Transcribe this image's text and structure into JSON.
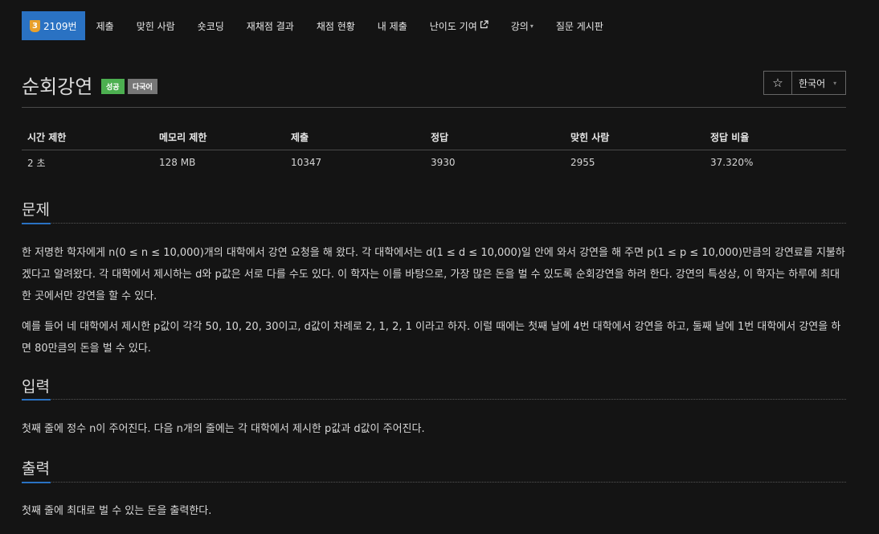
{
  "nav": {
    "problem_badge_tier": "3",
    "problem_number": "2109번",
    "items": [
      {
        "label": "제출"
      },
      {
        "label": "맞힌 사람"
      },
      {
        "label": "숏코딩"
      },
      {
        "label": "재채점 결과"
      },
      {
        "label": "채점 현황"
      },
      {
        "label": "내 제출"
      },
      {
        "label": "난이도 기여"
      },
      {
        "label": "강의"
      },
      {
        "label": "질문 게시판"
      }
    ],
    "difficulty_icon": "external-link-icon",
    "lecture_icon": "caret-down-icon"
  },
  "problem": {
    "title": "순회강연",
    "label_success": "성공",
    "label_lang": "다국어",
    "star_icon": "☆",
    "language": "한국어"
  },
  "info_table": {
    "headers": [
      "시간 제한",
      "메모리 제한",
      "제출",
      "정답",
      "맞힌 사람",
      "정답 비율"
    ],
    "values": [
      "2 초",
      "128 MB",
      "10347",
      "3930",
      "2955",
      "37.320%"
    ]
  },
  "sections": {
    "description": {
      "title": "문제",
      "paragraphs": [
        "한 저명한 학자에게 n(0 ≤ n ≤ 10,000)개의 대학에서 강연 요청을 해 왔다. 각 대학에서는 d(1 ≤ d ≤ 10,000)일 안에 와서 강연을 해 주면 p(1 ≤ p ≤ 10,000)만큼의 강연료를 지불하겠다고 알려왔다. 각 대학에서 제시하는 d와 p값은 서로 다를 수도 있다. 이 학자는 이를 바탕으로, 가장 많은 돈을 벌 수 있도록 순회강연을 하려 한다. 강연의 특성상, 이 학자는 하루에 최대 한 곳에서만 강연을 할 수 있다.",
        "예를 들어 네 대학에서 제시한 p값이 각각 50, 10, 20, 30이고, d값이 차례로 2, 1, 2, 1 이라고 하자. 이럴 때에는 첫째 날에 4번 대학에서 강연을 하고, 둘째 날에 1번 대학에서 강연을 하면 80만큼의 돈을 벌 수 있다."
      ]
    },
    "input": {
      "title": "입력",
      "text": "첫째 줄에 정수 n이 주어진다. 다음 n개의 줄에는 각 대학에서 제시한 p값과 d값이 주어진다."
    },
    "output": {
      "title": "출력",
      "text": "첫째 줄에 최대로 벌 수 있는 돈을 출력한다."
    }
  },
  "colors": {
    "accent": "#2a72c3",
    "success": "#4caf50",
    "tier_gold": "#e8a02b",
    "background": "#141414"
  }
}
